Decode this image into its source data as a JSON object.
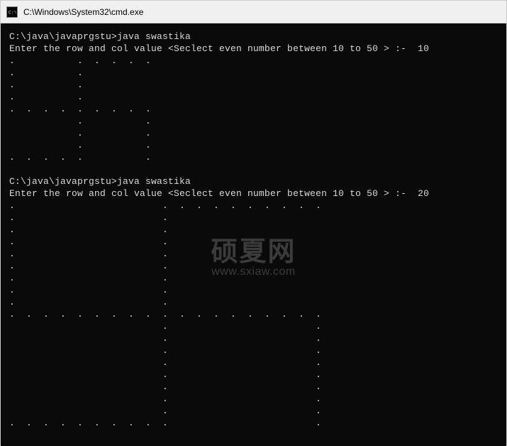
{
  "window": {
    "title": "C:\\Windows\\System32\\cmd.exe"
  },
  "terminal": {
    "run1": {
      "prompt": "C:\\java\\javaprgstu>java swastika",
      "input_line": "Enter the row and col value <Seclect even number between 10 to 50 > :-  10",
      "pattern": ".           .  .  .  .  .\n.           .\n.           .\n.           .\n.  .  .  .  .  .  .  .  .\n            .           .\n            .           .\n            .           .\n.  .  .  .  .           ."
    },
    "run2": {
      "prompt": "C:\\java\\javaprgstu>java swastika",
      "input_line": "Enter the row and col value <Seclect even number between 10 to 50 > :-  20",
      "pattern": ".                          .  .  .  .  .  .  .  .  .  .\n.                          .\n.                          .\n.                          .\n.                          .\n.                          .\n.                          .\n.                          .\n.                          .\n.  .  .  .  .  .  .  .  .  .  .  .  .  .  .  .  .  .  .\n                           .                          .\n                           .                          .\n                           .                          .\n                           .                          .\n                           .                          .\n                           .                          .\n                           .                          .\n                           .                          .\n.  .  .  .  .  .  .  .  .  .                          ."
    }
  },
  "watermark": {
    "cn": "硕夏网",
    "url": "www.sxiaw.com"
  }
}
